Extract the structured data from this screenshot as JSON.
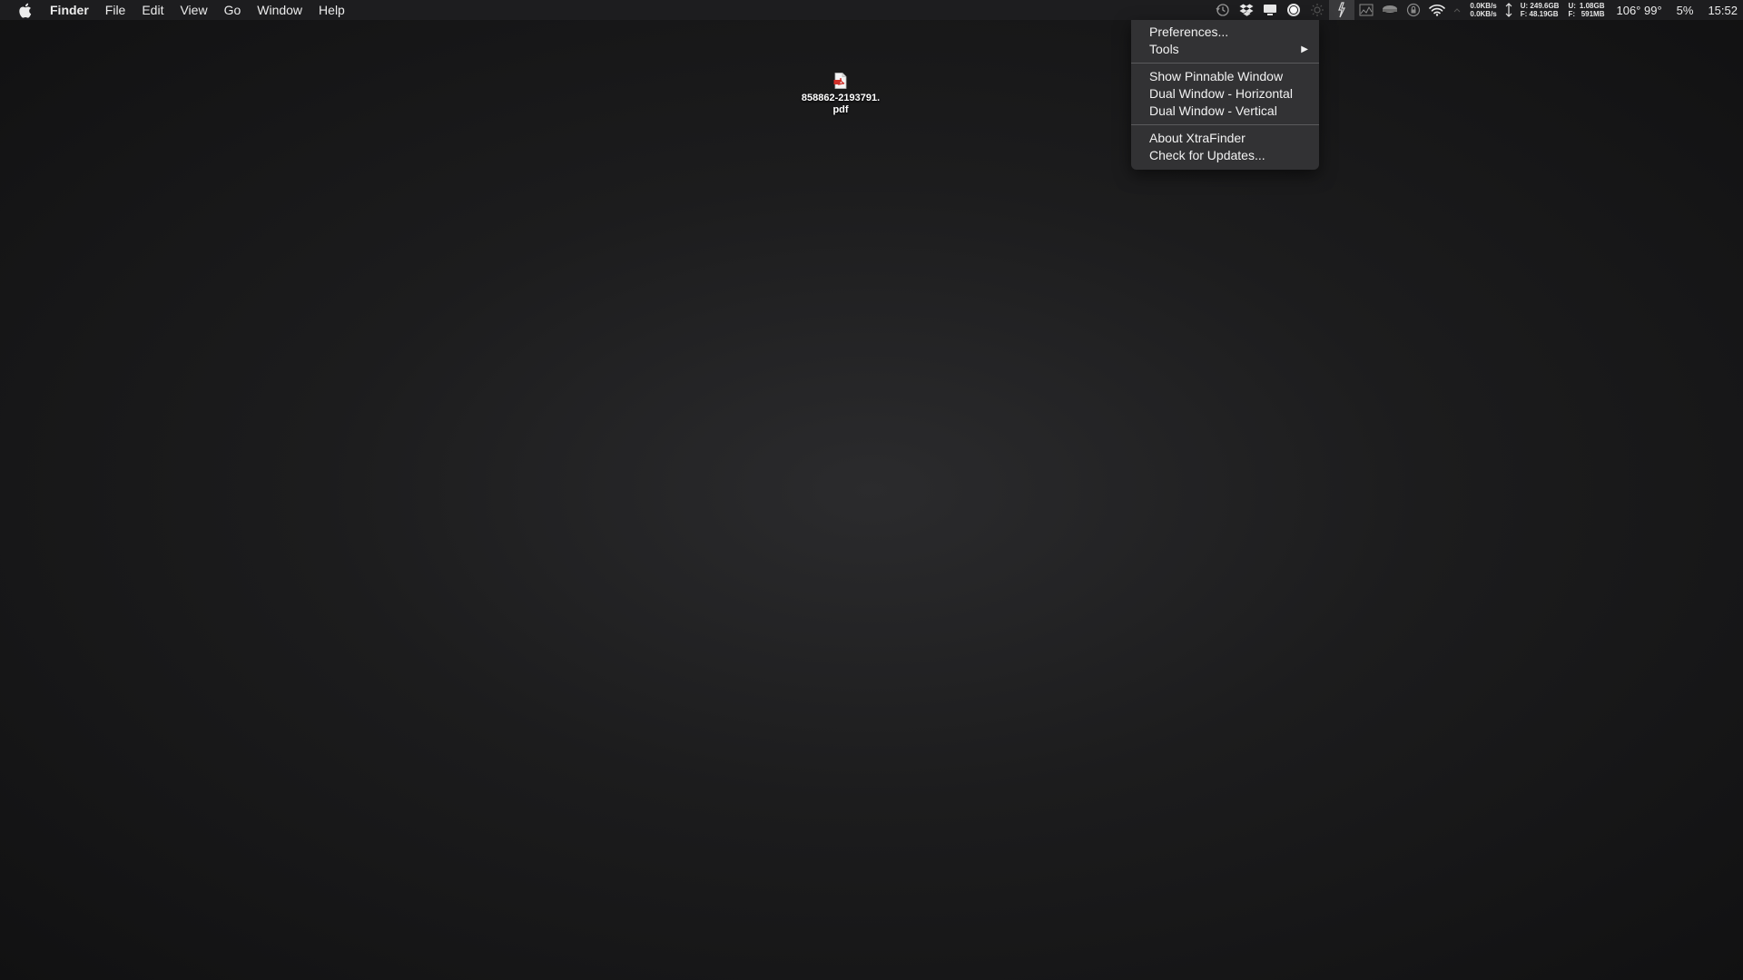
{
  "menubar": {
    "apple_icon": "apple-logo-icon",
    "app_name": "Finder",
    "menus": [
      "File",
      "Edit",
      "View",
      "Go",
      "Window",
      "Help"
    ]
  },
  "status": {
    "icons": [
      "time-machine-icon",
      "dropbox-icon",
      "display-icon",
      "record-icon",
      "brightness-icon",
      "xtrafinder-icon",
      "network-graph-icon",
      "drive-icon",
      "security-icon",
      "wifi-icon"
    ],
    "net_up": "0.0KB/s",
    "net_down": "0.0KB/s",
    "disk_used": "U: 249.6GB",
    "disk_free": "F: 48.19GB",
    "mem_used_label": "U:",
    "mem_free_label": "F:",
    "mem_used": "1.08GB",
    "mem_free": "591MB",
    "temperature": "106° 99°",
    "battery": "5%",
    "clock": "15:52"
  },
  "dropdown": {
    "items_group1": [
      {
        "label": "Preferences..."
      },
      {
        "label": "Tools",
        "submenu": true
      }
    ],
    "items_group2": [
      {
        "label": "Show Pinnable Window"
      },
      {
        "label": "Dual Window - Horizontal"
      },
      {
        "label": "Dual Window - Vertical"
      }
    ],
    "items_group3": [
      {
        "label": "About XtraFinder"
      },
      {
        "label": "Check for Updates..."
      }
    ],
    "submenu_arrow": "▶"
  },
  "desktop": {
    "file_icon": "pdf-file-icon",
    "file_name_line1": "858862-2193791.",
    "file_name_line2": "pdf"
  },
  "colors": {
    "menubar_bg": "#1d1d1f",
    "dropdown_bg": "#343436",
    "pdf_red": "#d0302a"
  }
}
